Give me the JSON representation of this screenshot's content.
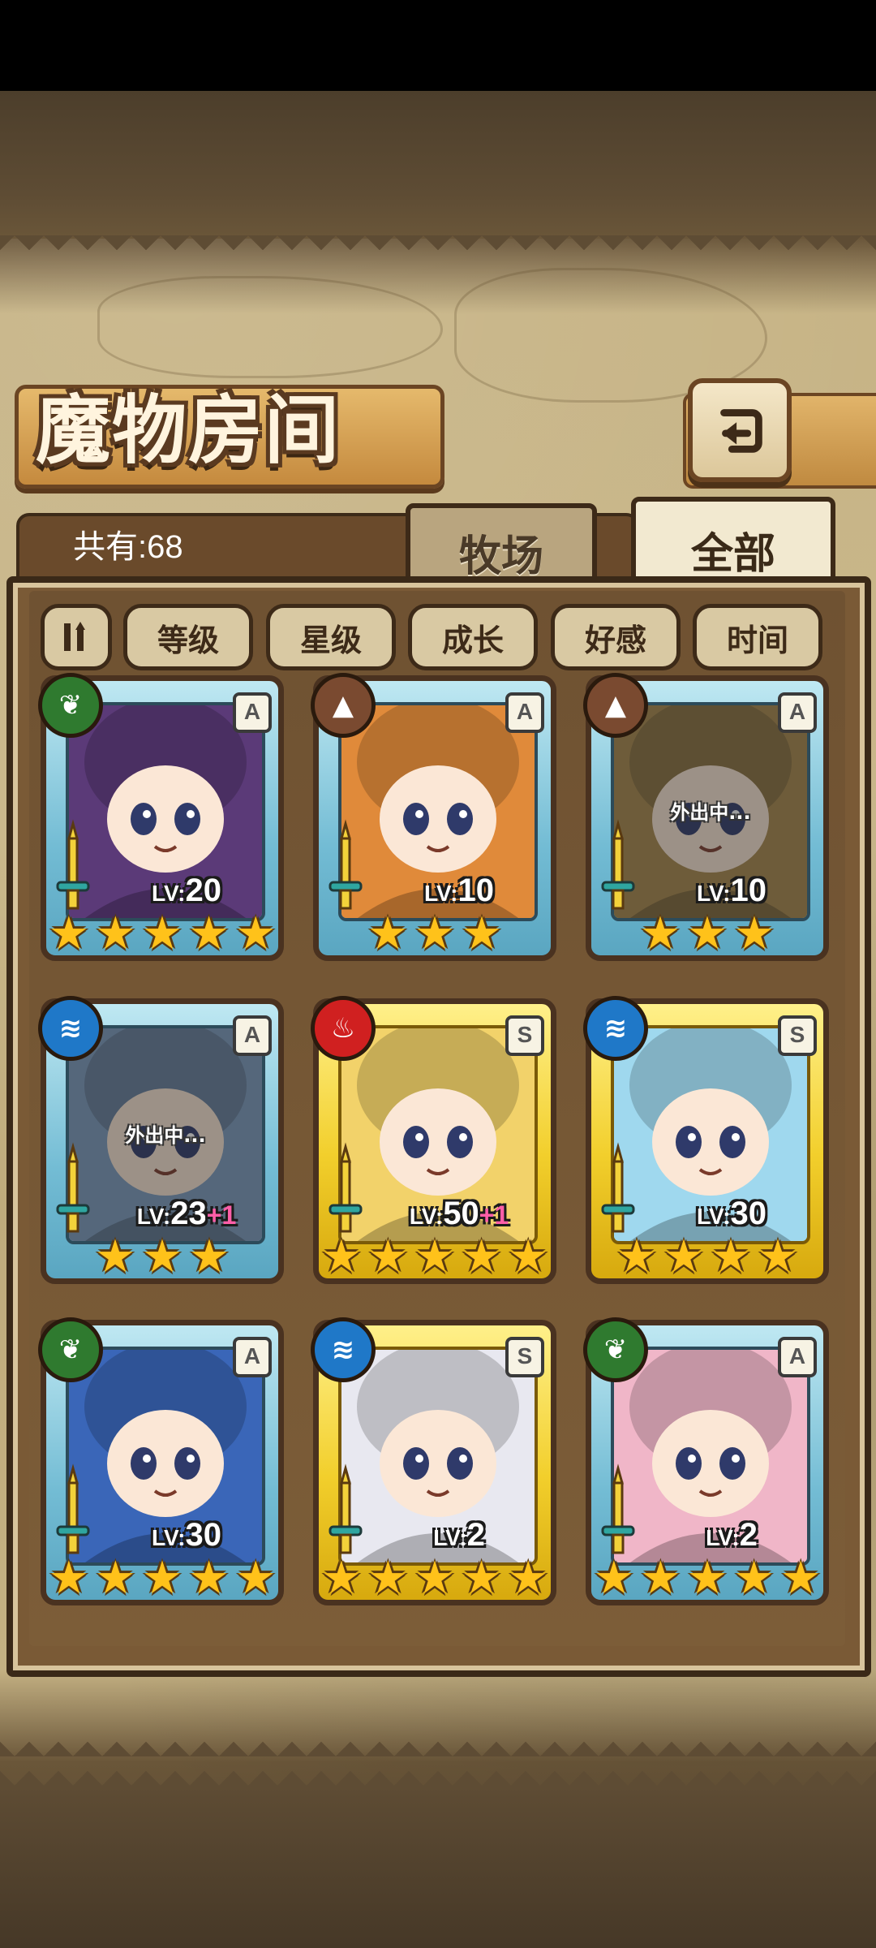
{
  "title": "魔物房间",
  "count_label": "共有:68",
  "tabs": [
    {
      "label": "牧场",
      "active": false
    },
    {
      "label": "全部",
      "active": true
    }
  ],
  "sort_buttons": [
    "等级",
    "星级",
    "成长",
    "好感",
    "时间"
  ],
  "colors": {
    "rank_a_frame": "#73bcd4",
    "rank_s_frame": "#f2cf2c",
    "element_nature": "#2f7a2f",
    "element_earth": "#7a4a30",
    "element_water": "#1f78c8",
    "element_fire": "#d02020",
    "level_plus": "#ff5ea8"
  },
  "cards": [
    {
      "element": "nature-icon",
      "rank": "A",
      "level_prefix": "LV:",
      "level": "20",
      "plus": "",
      "stars": 5,
      "away": "",
      "tint": "#5b3a78"
    },
    {
      "element": "earth-icon",
      "rank": "A",
      "level_prefix": "LV:",
      "level": "10",
      "plus": "",
      "stars": 3,
      "away": "",
      "tint": "#e08a3a"
    },
    {
      "element": "earth-icon",
      "rank": "A",
      "level_prefix": "LV:",
      "level": "10",
      "plus": "",
      "stars": 3,
      "away": "外出中...",
      "tint": "#a8884a"
    },
    {
      "element": "water-icon",
      "rank": "A",
      "level_prefix": "LV:",
      "level": "23",
      "plus": "+1",
      "stars": 3,
      "away": "外出中...",
      "tint": "#7a9cc0"
    },
    {
      "element": "fire-icon",
      "rank": "S",
      "level_prefix": "LV:",
      "level": "50",
      "plus": "+1",
      "stars": 5,
      "away": "",
      "tint": "#f2d26a"
    },
    {
      "element": "water-icon",
      "rank": "S",
      "level_prefix": "LV:",
      "level": "30",
      "plus": "",
      "stars": 4,
      "away": "",
      "tint": "#9fd8ee"
    },
    {
      "element": "nature-icon",
      "rank": "A",
      "level_prefix": "LV:",
      "level": "30",
      "plus": "",
      "stars": 5,
      "away": "",
      "tint": "#3a66b8"
    },
    {
      "element": "water-icon",
      "rank": "S",
      "level_prefix": "LV:",
      "level": "2",
      "plus": "",
      "stars": 5,
      "away": "",
      "tint": "#e8e8f0"
    },
    {
      "element": "nature-icon",
      "rank": "A",
      "level_prefix": "LV:",
      "level": "2",
      "plus": "",
      "stars": 5,
      "away": "",
      "tint": "#f0b6c8"
    }
  ]
}
